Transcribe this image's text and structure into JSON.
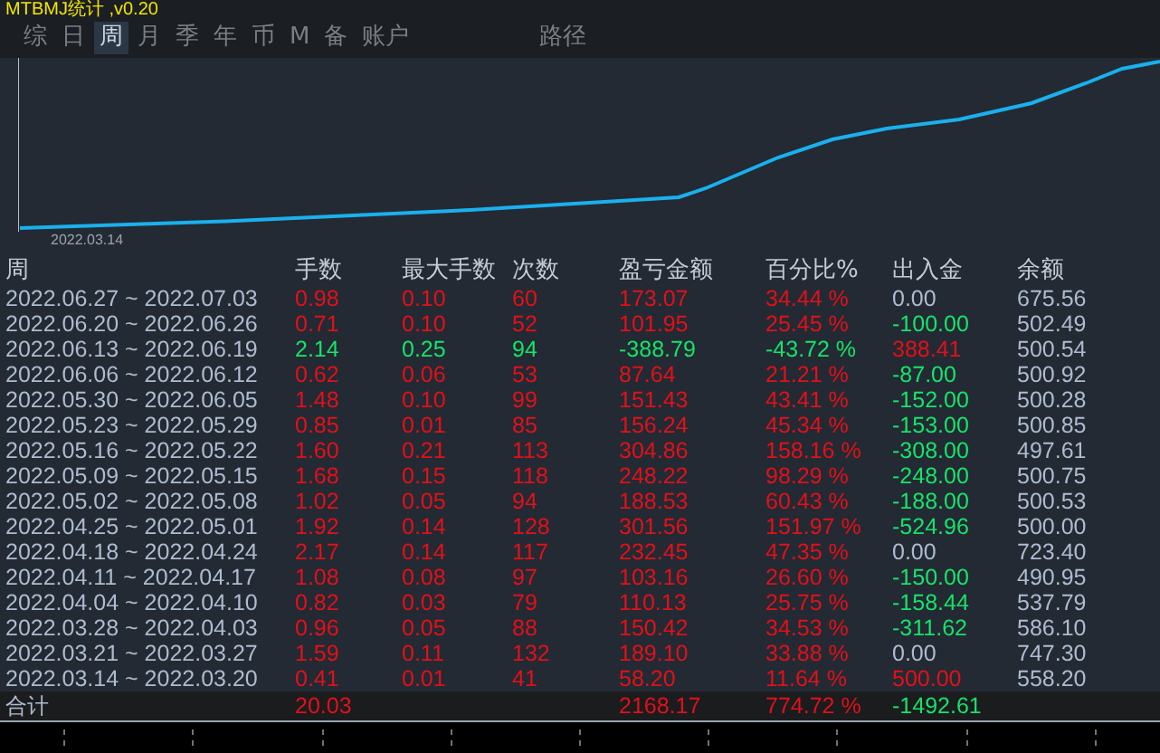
{
  "window": {
    "title": "MTBMJ统计 ,v0.20"
  },
  "tabs": [
    {
      "label": "综",
      "selected": false
    },
    {
      "label": "日",
      "selected": false
    },
    {
      "label": "周",
      "selected": true
    },
    {
      "label": "月",
      "selected": false
    },
    {
      "label": "季",
      "selected": false
    },
    {
      "label": "年",
      "selected": false
    },
    {
      "label": "币",
      "selected": false
    },
    {
      "label": "M",
      "selected": false
    },
    {
      "label": "备",
      "selected": false
    },
    {
      "label": "账户",
      "selected": false
    },
    {
      "label": "路径",
      "selected": false
    }
  ],
  "chart": {
    "start_label": "2022.03.14"
  },
  "table": {
    "columns": [
      "周",
      "手数",
      "最大手数",
      "次数",
      "盈亏金额",
      "百分比%",
      "出入金",
      "余额"
    ],
    "rows": [
      {
        "kind": "gain",
        "cells": [
          "2022.06.27 ~ 2022.07.03",
          "0.98",
          "0.10",
          "60",
          "173.07",
          "34.44 %"
        ],
        "flow": {
          "text": "0.00",
          "color": "#aebbd0"
        },
        "balance": "675.56"
      },
      {
        "kind": "gain",
        "cells": [
          "2022.06.20 ~ 2022.06.26",
          "0.71",
          "0.10",
          "52",
          "101.95",
          "25.45 %"
        ],
        "flow": {
          "text": "-100.00",
          "color": "#16e36a"
        },
        "balance": "502.49"
      },
      {
        "kind": "loss",
        "cells": [
          "2022.06.13 ~ 2022.06.19",
          "2.14",
          "0.25",
          "94",
          "-388.79",
          "-43.72 %"
        ],
        "flow": {
          "text": "388.41",
          "color": "#e3101a"
        },
        "balance": "500.54"
      },
      {
        "kind": "gain",
        "cells": [
          "2022.06.06 ~ 2022.06.12",
          "0.62",
          "0.06",
          "53",
          "87.64",
          "21.21 %"
        ],
        "flow": {
          "text": "-87.00",
          "color": "#16e36a"
        },
        "balance": "500.92"
      },
      {
        "kind": "gain",
        "cells": [
          "2022.05.30 ~ 2022.06.05",
          "1.48",
          "0.10",
          "99",
          "151.43",
          "43.41 %"
        ],
        "flow": {
          "text": "-152.00",
          "color": "#16e36a"
        },
        "balance": "500.28"
      },
      {
        "kind": "gain",
        "cells": [
          "2022.05.23 ~ 2022.05.29",
          "0.85",
          "0.01",
          "85",
          "156.24",
          "45.34 %"
        ],
        "flow": {
          "text": "-153.00",
          "color": "#16e36a"
        },
        "balance": "500.85"
      },
      {
        "kind": "gain",
        "cells": [
          "2022.05.16 ~ 2022.05.22",
          "1.60",
          "0.21",
          "113",
          "304.86",
          "158.16 %"
        ],
        "flow": {
          "text": "-308.00",
          "color": "#16e36a"
        },
        "balance": "497.61"
      },
      {
        "kind": "gain",
        "cells": [
          "2022.05.09 ~ 2022.05.15",
          "1.68",
          "0.15",
          "118",
          "248.22",
          "98.29 %"
        ],
        "flow": {
          "text": "-248.00",
          "color": "#16e36a"
        },
        "balance": "500.75"
      },
      {
        "kind": "gain",
        "cells": [
          "2022.05.02 ~ 2022.05.08",
          "1.02",
          "0.05",
          "94",
          "188.53",
          "60.43 %"
        ],
        "flow": {
          "text": "-188.00",
          "color": "#16e36a"
        },
        "balance": "500.53"
      },
      {
        "kind": "gain",
        "cells": [
          "2022.04.25 ~ 2022.05.01",
          "1.92",
          "0.14",
          "128",
          "301.56",
          "151.97 %"
        ],
        "flow": {
          "text": "-524.96",
          "color": "#16e36a"
        },
        "balance": "500.00"
      },
      {
        "kind": "gain",
        "cells": [
          "2022.04.18 ~ 2022.04.24",
          "2.17",
          "0.14",
          "117",
          "232.45",
          "47.35 %"
        ],
        "flow": {
          "text": "0.00",
          "color": "#aebbd0"
        },
        "balance": "723.40"
      },
      {
        "kind": "gain",
        "cells": [
          "2022.04.11 ~ 2022.04.17",
          "1.08",
          "0.08",
          "97",
          "103.16",
          "26.60 %"
        ],
        "flow": {
          "text": "-150.00",
          "color": "#16e36a"
        },
        "balance": "490.95"
      },
      {
        "kind": "gain",
        "cells": [
          "2022.04.04 ~ 2022.04.10",
          "0.82",
          "0.03",
          "79",
          "110.13",
          "25.75 %"
        ],
        "flow": {
          "text": "-158.44",
          "color": "#16e36a"
        },
        "balance": "537.79"
      },
      {
        "kind": "gain",
        "cells": [
          "2022.03.28 ~ 2022.04.03",
          "0.96",
          "0.05",
          "88",
          "150.42",
          "34.53 %"
        ],
        "flow": {
          "text": "-311.62",
          "color": "#16e36a"
        },
        "balance": "586.10"
      },
      {
        "kind": "gain",
        "cells": [
          "2022.03.21 ~ 2022.03.27",
          "1.59",
          "0.11",
          "132",
          "189.10",
          "33.88 %"
        ],
        "flow": {
          "text": "0.00",
          "color": "#aebbd0"
        },
        "balance": "747.30"
      },
      {
        "kind": "gain",
        "cells": [
          "2022.03.14 ~ 2022.03.20",
          "0.41",
          "0.01",
          "41",
          "58.20",
          "11.64 %"
        ],
        "flow": {
          "text": "500.00",
          "color": "#e3101a"
        },
        "balance": "558.20"
      }
    ],
    "total": {
      "label": "合计",
      "lots": "20.03",
      "pnl": "2168.17",
      "percent": "774.72 %",
      "flow_total": "-1492.61"
    }
  }
}
